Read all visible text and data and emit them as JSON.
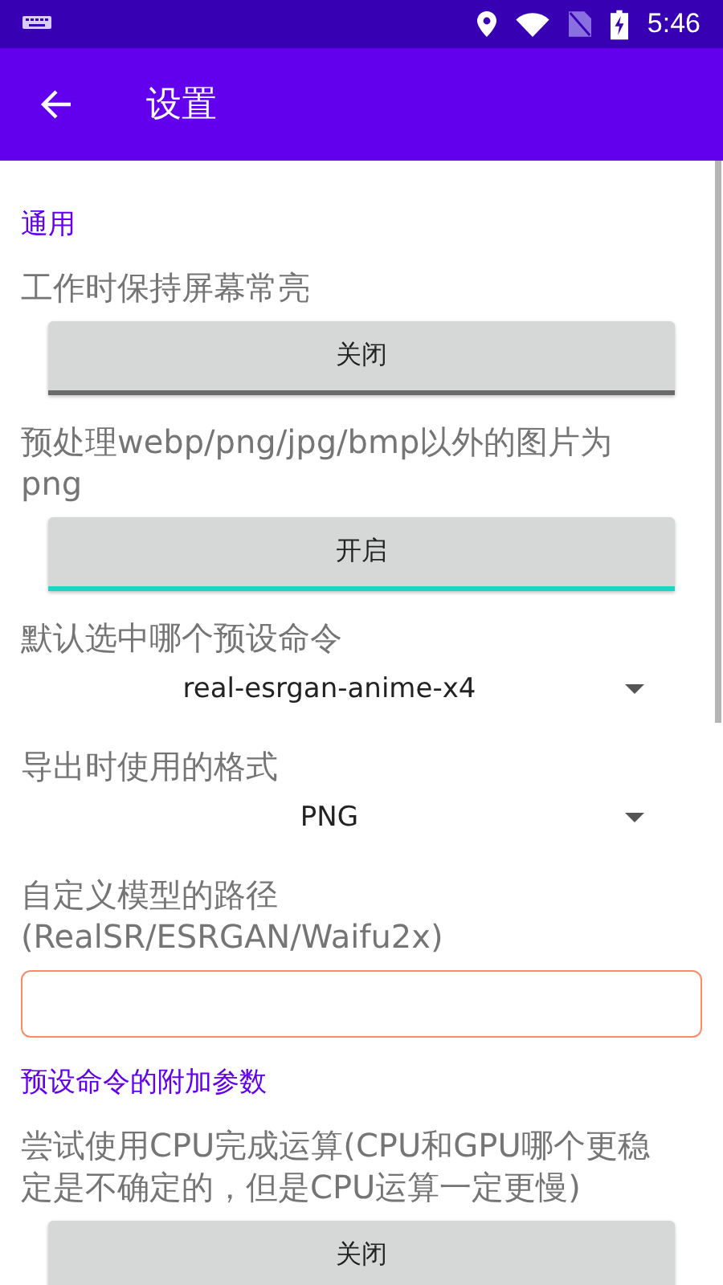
{
  "status_bar": {
    "time": "5:46"
  },
  "app_bar": {
    "title": "设置"
  },
  "settings": [
    {
      "kind": "section",
      "text": "通用"
    },
    {
      "kind": "toggle",
      "label": "工作时保持屏幕常亮",
      "button": "关闭",
      "on": false
    },
    {
      "kind": "toggle",
      "label": "预处理webp/png/jpg/bmp以外的图片为png",
      "button": "开启",
      "on": true
    },
    {
      "kind": "dropdown",
      "label": "默认选中哪个预设命令",
      "value": "real-esrgan-anime-x4"
    },
    {
      "kind": "dropdown",
      "label": "导出时使用的格式",
      "value": "PNG"
    },
    {
      "kind": "field",
      "label": "自定义模型的路径(RealSR/ESRGAN/Waifu2x)"
    },
    {
      "kind": "section",
      "text": "预设命令的附加参数"
    },
    {
      "kind": "toggle",
      "label": "尝试使用CPU完成运算(CPU和GPU哪个更稳定是不确定的，但是CPU运算一定更慢)",
      "button": "关闭"
    }
  ]
}
